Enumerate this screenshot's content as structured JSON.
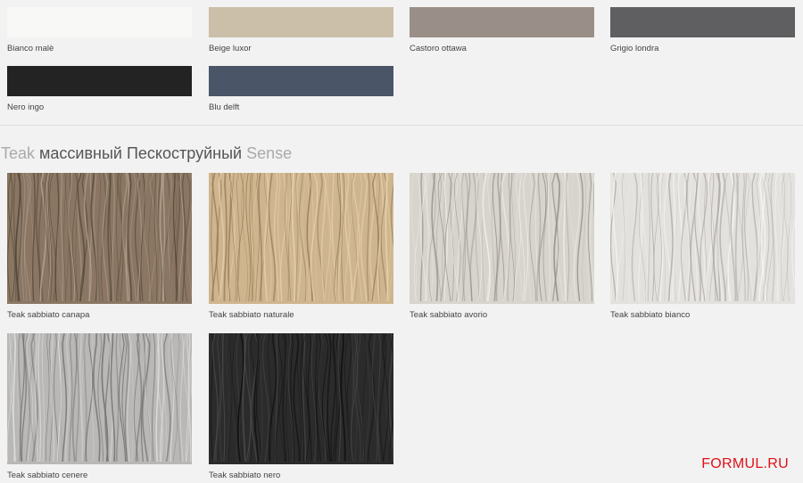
{
  "solid_colors": [
    {
      "name": "Bianco malè",
      "color": "#f8f8f6"
    },
    {
      "name": "Beige luxor",
      "color": "#cbbfa9"
    },
    {
      "name": "Castoro ottawa",
      "color": "#9a8f88"
    },
    {
      "name": "Grigio londra",
      "color": "#5f5f61"
    },
    {
      "name": "Nero ingo",
      "color": "#232323"
    },
    {
      "name": "Blu delft",
      "color": "#4b5568"
    }
  ],
  "section": {
    "prefix": "Teak",
    "bold": "массивный Пескоструйный",
    "suffix": "Sense"
  },
  "wood_finishes": [
    {
      "name": "Teak sabbiato canapa",
      "base": "#8a7663",
      "light": "#b6a794",
      "dark": "#4e4236"
    },
    {
      "name": "Teak sabbiato naturale",
      "base": "#cfb58e",
      "light": "#e6d3b3",
      "dark": "#8c7552"
    },
    {
      "name": "Teak sabbiato avorio",
      "base": "#d7d3cd",
      "light": "#f1efeb",
      "dark": "#8f8a82"
    },
    {
      "name": "Teak sabbiato bianco",
      "base": "#e3e1de",
      "light": "#f6f5f3",
      "dark": "#aaa59f"
    },
    {
      "name": "Teak sabbiato cenere",
      "base": "#b9b8b6",
      "light": "#e2e2e0",
      "dark": "#6f6e6c"
    },
    {
      "name": "Teak sabbiato nero",
      "base": "#2b2b2b",
      "light": "#4d4d4d",
      "dark": "#0e0e0e"
    }
  ],
  "watermark": "FORMUL.RU"
}
